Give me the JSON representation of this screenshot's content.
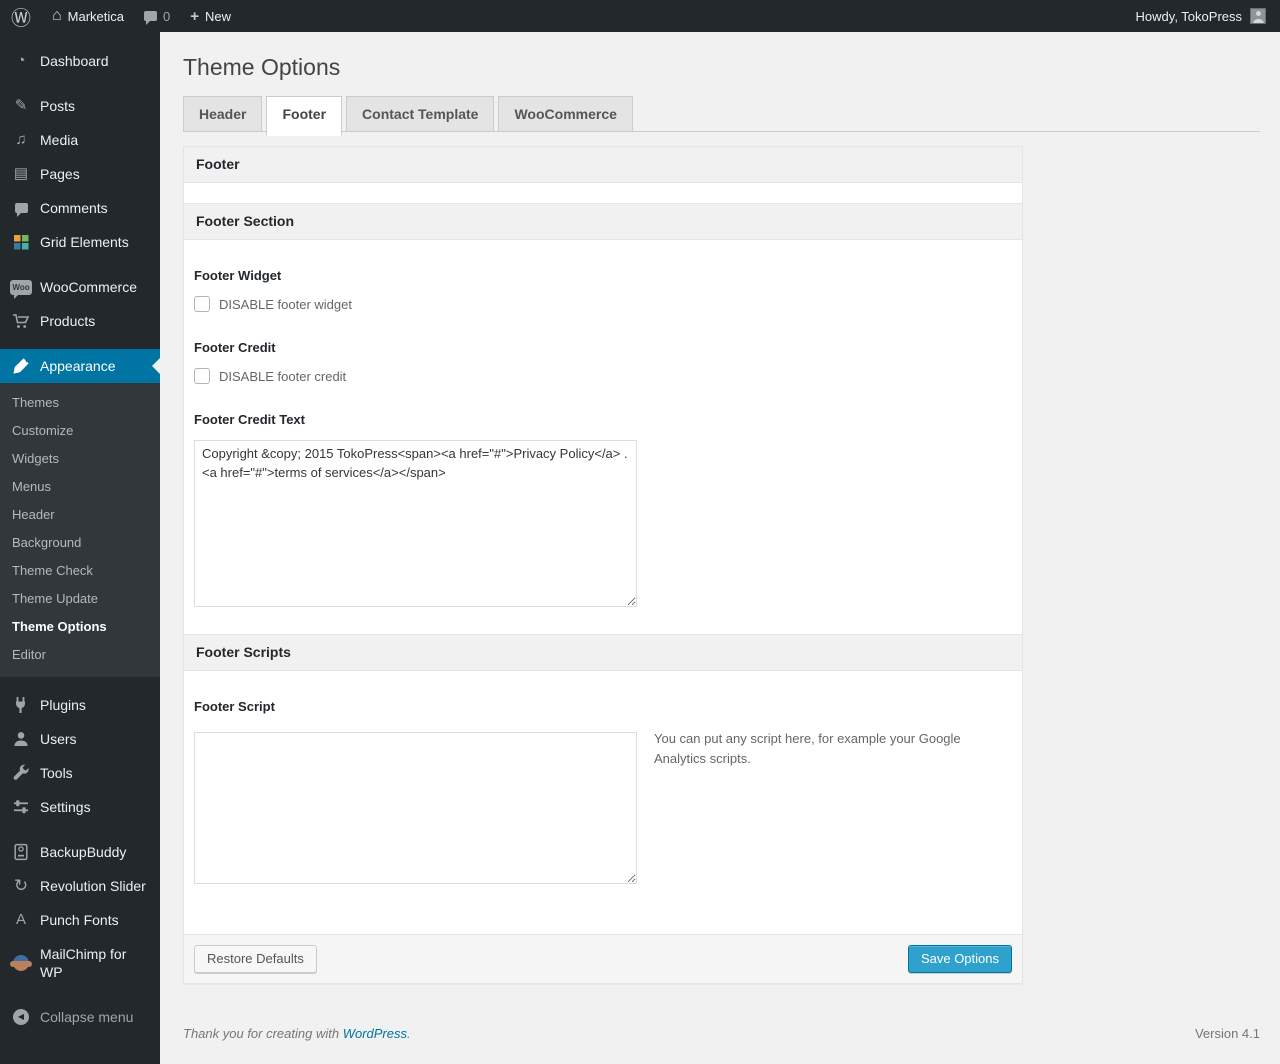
{
  "admin_bar": {
    "site_name": "Marketica",
    "comment_count": "0",
    "new_label": "New",
    "howdy": "Howdy, TokoPress"
  },
  "icons": {
    "wp_logo": "Ⓦ",
    "home": "⌂",
    "plus": "+",
    "dashboard": "◔",
    "posts": "✎",
    "media": "♫",
    "pages": "▤",
    "comments": "css-bubble",
    "grid_elements": "css-pinwheel",
    "woocommerce_badge_text": "Woo",
    "products": "svg-cart",
    "appearance": "svg-brush",
    "plugins": "svg-plug",
    "users": "svg-person",
    "tools": "svg-wrench",
    "settings": "svg-sliders",
    "backupbuddy": "svg-drive",
    "revolution_slider": "↻",
    "punch_fonts": "A",
    "mailchimp": "css-monkey",
    "collapse_arrow": "◀",
    "avatar": "css-person"
  },
  "sidebar": {
    "items": [
      {
        "label": "Dashboard"
      },
      {
        "label": "Posts"
      },
      {
        "label": "Media"
      },
      {
        "label": "Pages"
      },
      {
        "label": "Comments"
      },
      {
        "label": "Grid Elements"
      },
      {
        "label": "WooCommerce"
      },
      {
        "label": "Products"
      },
      {
        "label": "Appearance"
      },
      {
        "label": "Plugins"
      },
      {
        "label": "Users"
      },
      {
        "label": "Tools"
      },
      {
        "label": "Settings"
      },
      {
        "label": "BackupBuddy"
      },
      {
        "label": "Revolution Slider"
      },
      {
        "label": "Punch Fonts"
      },
      {
        "label": "MailChimp for WP"
      },
      {
        "label": "Collapse menu"
      }
    ],
    "appearance_submenu": [
      "Themes",
      "Customize",
      "Widgets",
      "Menus",
      "Header",
      "Background",
      "Theme Check",
      "Theme Update",
      "Theme Options",
      "Editor"
    ],
    "current_submenu_item": "Theme Options"
  },
  "main": {
    "page_title": "Theme Options",
    "tabs": [
      {
        "label": "Header"
      },
      {
        "label": "Footer"
      },
      {
        "label": "Contact Template"
      },
      {
        "label": "WooCommerce"
      }
    ],
    "active_tab": "Footer",
    "panel_title": "Footer",
    "footer_section_title": "Footer Section",
    "footer_widget_label": "Footer Widget",
    "footer_widget_checkbox_label": "DISABLE footer widget",
    "footer_credit_label": "Footer Credit",
    "footer_credit_checkbox_label": "DISABLE footer credit",
    "footer_credit_text_label": "Footer Credit Text",
    "footer_credit_text_value": "Copyright &copy; 2015 TokoPress<span><a href=\"#\">Privacy Policy</a> . <a href=\"#\">terms of services</a></span>",
    "footer_scripts_title": "Footer Scripts",
    "footer_script_label": "Footer Script",
    "footer_script_value": "",
    "footer_script_help": "You can put any script here, for example your Google Analytics scripts.",
    "restore_button_label": "Restore Defaults",
    "save_button_label": "Save Options"
  },
  "page_footer": {
    "thanks_prefix": "Thank you for creating with",
    "wordpress_link": "WordPress",
    "thanks_suffix": ".",
    "version": "Version 4.1"
  },
  "colors": {
    "accent": "#0074a2",
    "primary_button": "#2ea2cc",
    "adminbar_bg": "#23282d",
    "submenu_bg": "#32373c",
    "page_bg": "#f1f1f1"
  }
}
